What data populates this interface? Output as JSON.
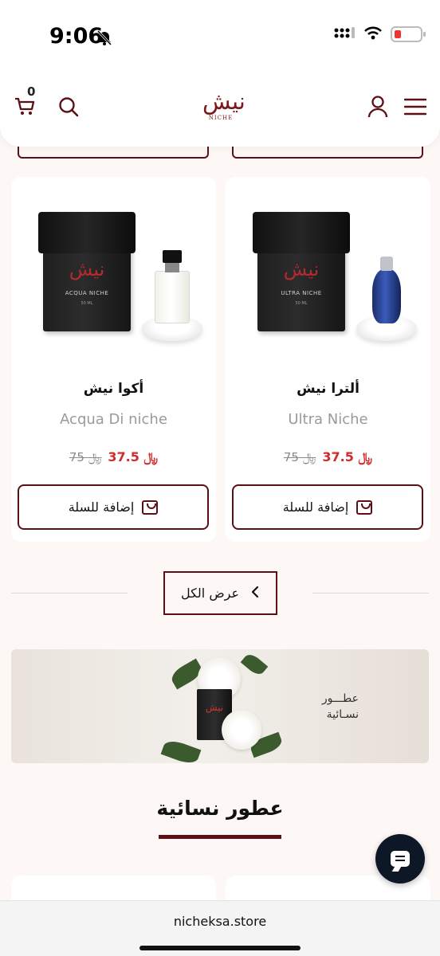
{
  "status": {
    "time": "9:06"
  },
  "header": {
    "cart_count": "0",
    "logo_ar": "نيش",
    "logo_en": "NICHE"
  },
  "products": [
    {
      "name_ar": "ألترا نيش",
      "name_en": "Ultra Niche",
      "box_label": "ULTRA NICHE",
      "box_size": "50 ML",
      "price_new": "37.5",
      "price_old": "75",
      "currency": "﷼",
      "add_label": "إضافة للسلة"
    },
    {
      "name_ar": "أكوا نيش",
      "name_en": "Acqua Di niche",
      "box_label": "ACQUA NICHE",
      "box_size": "50 ML",
      "price_new": "37.5",
      "price_old": "75",
      "currency": "﷼",
      "add_label": "إضافة للسلة"
    }
  ],
  "view_all_label": "عرض الكل",
  "banner": {
    "line1": "عطـــور",
    "line2": "نسـائية",
    "box_label": "نيش"
  },
  "section_title": "عطور نسائية",
  "browser": {
    "url": "nicheksa.store"
  },
  "colors": {
    "brand": "#5c0f15",
    "price": "#d22a2a",
    "background": "#fdf7f6"
  },
  "icons": [
    "bell-slash-icon",
    "signal-icon",
    "wifi-icon",
    "battery-icon",
    "cart-icon",
    "search-icon",
    "user-icon",
    "menu-icon",
    "chevron-left-icon",
    "chat-icon"
  ]
}
